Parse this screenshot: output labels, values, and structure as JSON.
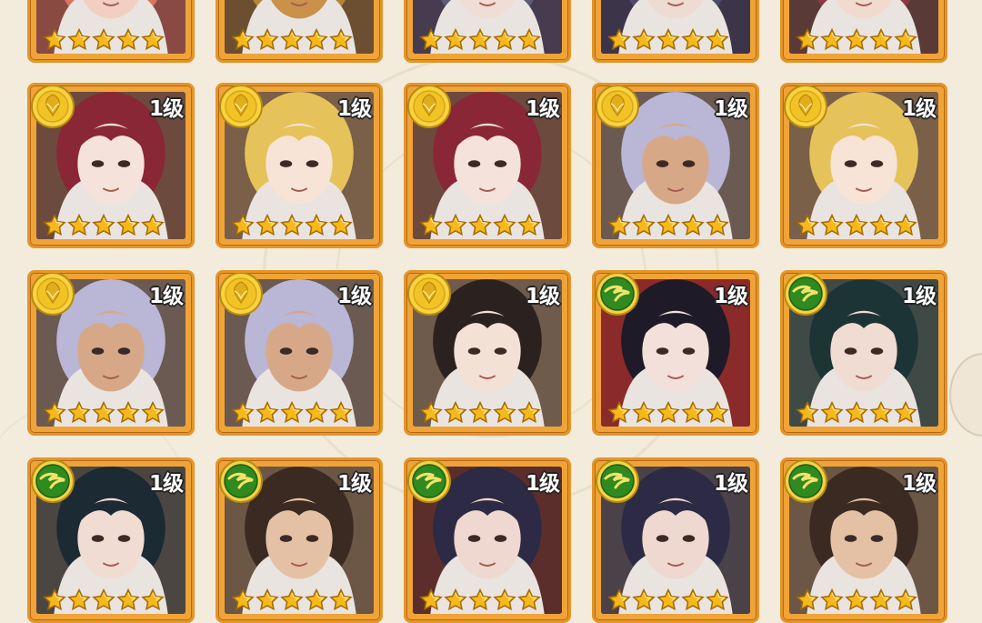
{
  "level_label": "1级",
  "colors": {
    "frame": "#e49527",
    "gold_badge": "#f2c326",
    "green_badge": "#2f8a1f",
    "star": "#f6b81a"
  },
  "cards": [
    {
      "row": 0,
      "col": 0,
      "badge": "none",
      "stars": 5,
      "level": "",
      "hair": "#d47760",
      "bg": "#8a4a44",
      "skin": "#f2cfc2"
    },
    {
      "row": 0,
      "col": 1,
      "badge": "none",
      "stars": 5,
      "level": "",
      "hair": "#b58535",
      "bg": "#6b4f30",
      "skin": "#c9914a"
    },
    {
      "row": 0,
      "col": 2,
      "badge": "none",
      "stars": 5,
      "level": "",
      "hair": "#5d5a7a",
      "bg": "#463b4f",
      "skin": "#f0ddd5"
    },
    {
      "row": 0,
      "col": 3,
      "badge": "none",
      "stars": 5,
      "level": "",
      "hair": "#4c4c68",
      "bg": "#3c3448",
      "skin": "#eedbd2"
    },
    {
      "row": 0,
      "col": 4,
      "badge": "none",
      "stars": 5,
      "level": "",
      "hair": "#8d3a46",
      "bg": "#5a3a36",
      "skin": "#f1dad0"
    },
    {
      "row": 1,
      "col": 0,
      "badge": "gold",
      "stars": 5,
      "level": "1级",
      "hair": "#8a2736",
      "bg": "#6c4b3e",
      "skin": "#f5e3db"
    },
    {
      "row": 1,
      "col": 1,
      "badge": "gold",
      "stars": 5,
      "level": "1级",
      "hair": "#e6c25a",
      "bg": "#7a6048",
      "skin": "#f7e4d6"
    },
    {
      "row": 1,
      "col": 2,
      "badge": "gold",
      "stars": 5,
      "level": "1级",
      "hair": "#8a2736",
      "bg": "#6c4b3e",
      "skin": "#f5e3db"
    },
    {
      "row": 1,
      "col": 3,
      "badge": "gold",
      "stars": 5,
      "level": "1级",
      "hair": "#b9b6d6",
      "bg": "#6a5a52",
      "skin": "#d7a887"
    },
    {
      "row": 1,
      "col": 4,
      "badge": "gold",
      "stars": 5,
      "level": "1级",
      "hair": "#e6c25a",
      "bg": "#7a6048",
      "skin": "#f7e4d6"
    },
    {
      "row": 2,
      "col": 0,
      "badge": "gold",
      "stars": 5,
      "level": "1级",
      "hair": "#b9b6d6",
      "bg": "#6a5a52",
      "skin": "#d7a887"
    },
    {
      "row": 2,
      "col": 1,
      "badge": "gold",
      "stars": 5,
      "level": "1级",
      "hair": "#b9b6d6",
      "bg": "#6a5a52",
      "skin": "#d7a887"
    },
    {
      "row": 2,
      "col": 2,
      "badge": "gold",
      "stars": 5,
      "level": "1级",
      "hair": "#2b2220",
      "bg": "#6e5b4c",
      "skin": "#f4e1d6"
    },
    {
      "row": 2,
      "col": 3,
      "badge": "green",
      "stars": 5,
      "level": "1级",
      "hair": "#1f1a28",
      "bg": "#8a2a2a",
      "skin": "#f3e0da"
    },
    {
      "row": 2,
      "col": 4,
      "badge": "green",
      "stars": 5,
      "level": "1级",
      "hair": "#1d3436",
      "bg": "#3f4a46",
      "skin": "#f0dcd3"
    },
    {
      "row": 3,
      "col": 0,
      "badge": "green",
      "stars": 5,
      "level": "1级",
      "hair": "#1c2a34",
      "bg": "#4b4642",
      "skin": "#f0dcd3"
    },
    {
      "row": 3,
      "col": 1,
      "badge": "green",
      "stars": 5,
      "level": "1级",
      "hair": "#3a2a22",
      "bg": "#6c5646",
      "skin": "#e4c1a5"
    },
    {
      "row": 3,
      "col": 2,
      "badge": "green",
      "stars": 5,
      "level": "1级",
      "hair": "#2c2a44",
      "bg": "#5b2e2c",
      "skin": "#eed8cf"
    },
    {
      "row": 3,
      "col": 3,
      "badge": "green",
      "stars": 5,
      "level": "1级",
      "hair": "#2c2a44",
      "bg": "#4b4148",
      "skin": "#eed8cf"
    },
    {
      "row": 3,
      "col": 4,
      "badge": "green",
      "stars": 5,
      "level": "1级",
      "hair": "#3a2a22",
      "bg": "#6c5646",
      "skin": "#e4c1a5"
    }
  ]
}
